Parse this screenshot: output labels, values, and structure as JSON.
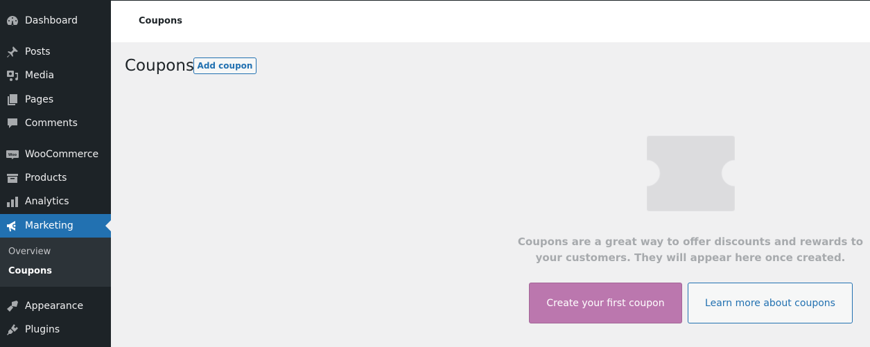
{
  "sidebar": {
    "items": [
      {
        "label": "Dashboard",
        "icon": "dashboard-icon"
      },
      {
        "label": "Posts",
        "icon": "pin-icon"
      },
      {
        "label": "Media",
        "icon": "media-icon"
      },
      {
        "label": "Pages",
        "icon": "pages-icon"
      },
      {
        "label": "Comments",
        "icon": "comment-icon"
      },
      {
        "label": "WooCommerce",
        "icon": "woo-icon"
      },
      {
        "label": "Products",
        "icon": "archive-icon"
      },
      {
        "label": "Analytics",
        "icon": "bar-chart-icon"
      },
      {
        "label": "Marketing",
        "icon": "megaphone-icon",
        "active": true
      },
      {
        "label": "Appearance",
        "icon": "paintbrush-icon"
      },
      {
        "label": "Plugins",
        "icon": "plugin-icon"
      }
    ],
    "submenu": [
      {
        "label": "Overview"
      },
      {
        "label": "Coupons",
        "current": true
      }
    ]
  },
  "topbar": {
    "title": "Coupons"
  },
  "page": {
    "title": "Coupons",
    "add_button": "Add coupon"
  },
  "empty_state": {
    "message": "Coupons are a great way to offer discounts and rewards to your customers. They will appear here once created.",
    "primary_button": "Create your first coupon",
    "secondary_button": "Learn more about coupons"
  },
  "colors": {
    "sidebar_bg": "#1d2327",
    "accent": "#2271b1",
    "woo_purple": "#bb77ae",
    "background": "#f0f0f1"
  }
}
